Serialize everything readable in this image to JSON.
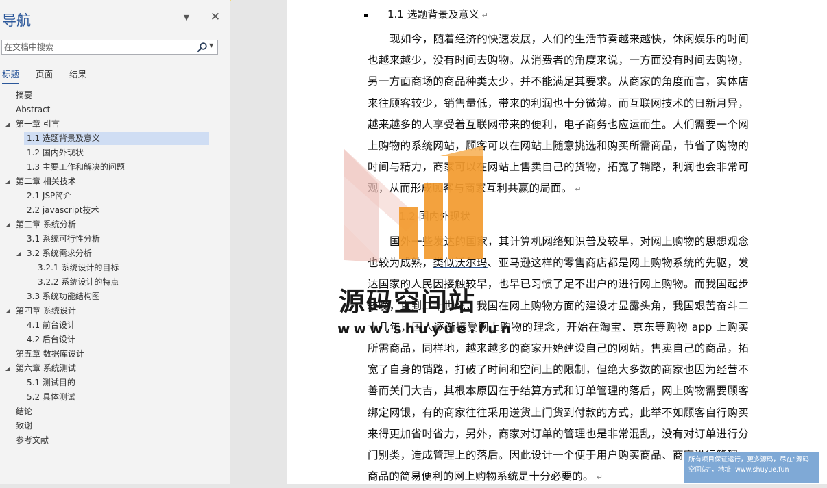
{
  "nav": {
    "title": "导航",
    "search_placeholder": "在文档中搜索",
    "tabs": [
      {
        "label": "标题",
        "active": true
      },
      {
        "label": "页面",
        "active": false
      },
      {
        "label": "结果",
        "active": false
      }
    ],
    "tree": [
      {
        "label": "摘要",
        "level": 1,
        "expandable": false,
        "selected": false
      },
      {
        "label": "Abstract",
        "level": 1,
        "expandable": false,
        "selected": false
      },
      {
        "label": "第一章 引言",
        "level": 1,
        "expandable": true,
        "selected": false
      },
      {
        "label": "1.1 选题背景及意义",
        "level": 2,
        "expandable": false,
        "selected": true
      },
      {
        "label": "1.2 国内外现状",
        "level": 2,
        "expandable": false,
        "selected": false
      },
      {
        "label": "1.3 主要工作和解决的问题",
        "level": 2,
        "expandable": false,
        "selected": false
      },
      {
        "label": "第二章 相关技术",
        "level": 1,
        "expandable": true,
        "selected": false
      },
      {
        "label": "2.1 JSP简介",
        "level": 2,
        "expandable": false,
        "selected": false
      },
      {
        "label": "2.2 javascript技术",
        "level": 2,
        "expandable": false,
        "selected": false
      },
      {
        "label": "第三章 系统分析",
        "level": 1,
        "expandable": true,
        "selected": false
      },
      {
        "label": "3.1 系统可行性分析",
        "level": 2,
        "expandable": false,
        "selected": false
      },
      {
        "label": "3.2 系统需求分析",
        "level": 2,
        "expandable": true,
        "selected": false
      },
      {
        "label": "3.2.1 系统设计的目标",
        "level": 3,
        "expandable": false,
        "selected": false
      },
      {
        "label": "3.2.2 系统设计的特点",
        "level": 3,
        "expandable": false,
        "selected": false
      },
      {
        "label": "3.3 系统功能结构图",
        "level": 2,
        "expandable": false,
        "selected": false
      },
      {
        "label": "第四章 系统设计",
        "level": 1,
        "expandable": true,
        "selected": false
      },
      {
        "label": "4.1 前台设计",
        "level": 2,
        "expandable": false,
        "selected": false
      },
      {
        "label": "4.2 后台设计",
        "level": 2,
        "expandable": false,
        "selected": false
      },
      {
        "label": "第五章 数据库设计",
        "level": 1,
        "expandable": false,
        "selected": false
      },
      {
        "label": "第六章 系统测试",
        "level": 1,
        "expandable": true,
        "selected": false
      },
      {
        "label": "5.1 测试目的",
        "level": 2,
        "expandable": false,
        "selected": false
      },
      {
        "label": "5.2 具体测试",
        "level": 2,
        "expandable": false,
        "selected": false
      },
      {
        "label": "结论",
        "level": 1,
        "expandable": false,
        "selected": false
      },
      {
        "label": "致谢",
        "level": 1,
        "expandable": false,
        "selected": false
      },
      {
        "label": "参考文献",
        "level": 1,
        "expandable": false,
        "selected": false
      }
    ]
  },
  "document": {
    "heading1": "1.1 选题背景及意义",
    "para1": "现如今，随着经济的快速发展，人们的生活节奏越来越快，休闲娱乐的时间也越来越少，没有时间去购物。从消费者的角度来说，一方面没有时间去购物，另一方面商场的商品种类太少，并不能满足其要求。从商家的角度而言，实体店来往顾客较少，销售量低，带来的利润也十分微薄。而互联网技术的日新月异，越来越多的人享受着互联网带来的便利，电子商务也应运而生。人们需要一个网上购物的系统网站，顾客可以在网站上随意挑选和购买所需商品，节省了购物的时间与精力，商家可以在网站上售卖自己的货物，拓宽了销路，利润也会非常可观，从而形成顾客与商家互利共赢的局面。",
    "heading2": "1.2 国内外现状",
    "para2_a": "国外一些发达的国家，其计算机网络知识普及较早，对网上购物的思想观念也较为成熟，",
    "para2_link": "类似沃尔玛",
    "para2_b": "、亚马逊这样的零售商店都是网上购物系统的先驱，发达国家的人民因接触较早，也早已习惯了足不出户的进行网上购物。而我国起步较晚，直到二十世纪，我国在网上购物方面的建设才显露头角，我国艰苦奋斗二十几年，国人逐渐接受网上购物的理念，开始在淘宝、京东等购物 app 上购买所需商品，同样地，越来越多的商家开始建设自己的网站，售卖自己的商品，拓宽了自身的销路，打破了时间和空间上的限制，但绝大多数的商家也因为经营不善而关门大吉，其根本原因在于结算方式和订单管理的落后，网上购物需要顾客绑定网银，有的商家往往采用送货上门货到付款的方式，此举不如顾客自行购买来得更加省时省力，另外，商家对订单的管理也是非常混乱，没有对订单进行分门别类，造成管理上的落后。因此设计一个便于用户购买商品、商家进行管理，商品的简易便利的网上购物系统是十分必要的。"
  },
  "watermark": {
    "title": "源码空间站",
    "url": "www.shuyue.fun",
    "notice": "所有项目保证运行，更多源码，尽在“源码空间站”，地址: www.shuyue.fun"
  }
}
